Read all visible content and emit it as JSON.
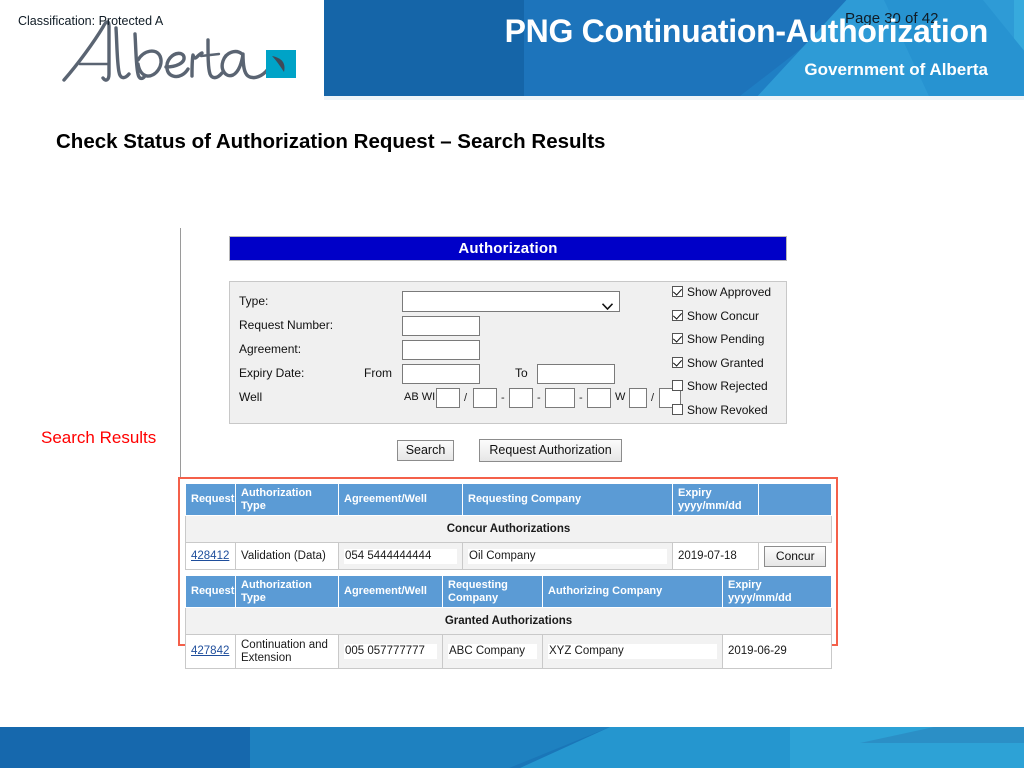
{
  "header": {
    "title": "PNG Continuation-Authorization",
    "subtitle": "Government of Alberta",
    "logo_alt": "Alberta",
    "colors": {
      "dark_blue": "#1565a8",
      "mid_blue": "#1f7fc4",
      "light_cyan": "#37aadd"
    }
  },
  "slide": {
    "title": "Check Status of Authorization Request – Search Results",
    "callout_label": "Search Results",
    "callout_color": "#ff0000"
  },
  "app": {
    "window_title": "Authorization",
    "window_title_bg": "#0000c8",
    "form": {
      "fields": [
        {
          "label": "Type:",
          "kind": "select",
          "value": ""
        },
        {
          "label": "Request Number:",
          "kind": "text",
          "value": ""
        },
        {
          "label": "Agreement:",
          "kind": "text",
          "value": ""
        }
      ],
      "expiry": {
        "label": "Expiry Date:",
        "from_label": "From",
        "from_value": "",
        "to_label": "To",
        "to_value": ""
      },
      "well": {
        "label": "Well",
        "prefix": "AB WI",
        "sep1": "/",
        "sep2": "-",
        "sep3": "-",
        "sep4": "-",
        "w_label": "W",
        "sep5": "/",
        "values": [
          "",
          "",
          "",
          "",
          "",
          "",
          ""
        ]
      }
    },
    "filters": [
      {
        "label": "Show Approved",
        "checked": true
      },
      {
        "label": "Show Concur",
        "checked": true
      },
      {
        "label": "Show Pending",
        "checked": true
      },
      {
        "label": "Show Granted",
        "checked": true
      },
      {
        "label": "Show Rejected",
        "checked": false
      },
      {
        "label": "Show Revoked",
        "checked": false
      }
    ],
    "buttons": {
      "search": "Search",
      "request_authorization": "Request Authorization"
    }
  },
  "results": {
    "border_color": "#f4604a",
    "concur": {
      "caption": "Concur Authorizations",
      "columns": [
        "Request",
        "Authorization Type",
        "Agreement/Well",
        "Requesting Company",
        "Expiry yyyy/mm/dd",
        ""
      ],
      "expiry_header_line1": "Expiry",
      "expiry_header_line2": "yyyy/mm/dd",
      "rows": [
        {
          "request": "428412",
          "authorization_type": "Validation (Data)",
          "agreement_well": "054 5444444444",
          "requesting_company": "Oil Company",
          "expiry": "2019-07-18",
          "action": "Concur"
        }
      ]
    },
    "granted": {
      "caption": "Granted Authorizations",
      "columns": [
        "Request",
        "Authorization Type",
        "Agreement/Well",
        "Requesting Company",
        "Authorizing Company",
        "Expiry yyyy/mm/dd"
      ],
      "expiry_header_line1": "Expiry",
      "expiry_header_line2": "yyyy/mm/dd",
      "rows": [
        {
          "request": "427842",
          "authorization_type": "Continuation and Extension",
          "agreement_well": "005 057777777",
          "requesting_company": "ABC Company",
          "authorizing_company": "XYZ Company",
          "expiry": "2019-06-29"
        }
      ]
    }
  },
  "footer": {
    "classification": "Classification: Protected A",
    "page": "Page 30 of 42"
  }
}
